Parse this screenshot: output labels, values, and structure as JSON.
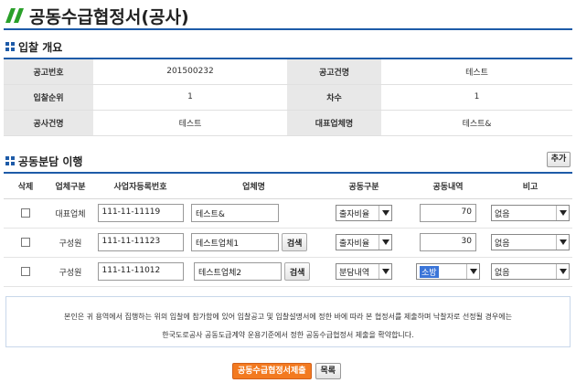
{
  "page": {
    "title": "공동수급협정서(공사)"
  },
  "colors": {
    "accent": "#1e5ba8",
    "title_icon": "#2aa02a",
    "submit_button": "#f37a20"
  },
  "overview": {
    "heading": "입찰 개요",
    "rows": [
      {
        "label1": "공고번호",
        "value1": "201500232",
        "label2": "공고건명",
        "value2": "테스트"
      },
      {
        "label1": "입찰순위",
        "value1": "1",
        "label2": "차수",
        "value2": "1"
      },
      {
        "label1": "공사건명",
        "value1": "테스트",
        "label2": "대표업체명",
        "value2": "테스트&"
      }
    ]
  },
  "share": {
    "heading": "공동분담 이행",
    "add_label": "추가",
    "columns": [
      "삭제",
      "업체구분",
      "사업자등록번호",
      "업체명",
      "공동구분",
      "공동내역",
      "비고"
    ],
    "search_label": "검색",
    "rows": [
      {
        "type": "대표업체",
        "biz_no": "111-11-11119",
        "name": "테스트&",
        "joint_type": "출자비율",
        "detail": "70",
        "note": "없음"
      },
      {
        "type": "구성원",
        "biz_no": "111-11-11123",
        "name": "테스트업체1",
        "joint_type": "출자비율",
        "detail": "30",
        "note": "없음"
      },
      {
        "type": "구성원",
        "biz_no": "111-11-11012",
        "name": "테스트업체2",
        "joint_type": "분담내역",
        "detail": "소방",
        "note": "없음"
      }
    ]
  },
  "notice": {
    "line1": "본인은 귀 용역에서 집행하는 위의 입찰에 참가함에 있어 입찰공고 및 입찰설명서에 정한 바에 따라 본 협정서를 제출하며 낙찰자로 선정될 경우에는",
    "line2": "한국도로공사 공동도급계약 운용기준에서 정한 공동수급협정서 제출을 확약합니다."
  },
  "footer": {
    "submit_label": "공동수급협정서제출",
    "list_label": "목록"
  }
}
